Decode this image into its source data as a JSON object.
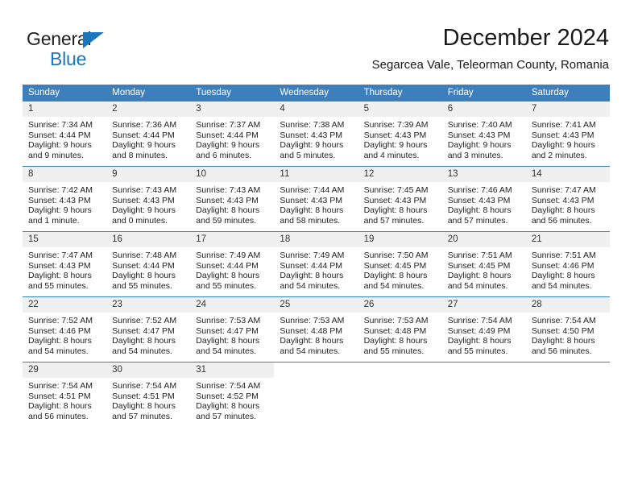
{
  "brand": {
    "name_part1": "General",
    "name_part2": "Blue",
    "logo_icon": "triangle-icon",
    "color_dark": "#231f20",
    "color_blue": "#1b75bb"
  },
  "header": {
    "title": "December 2024",
    "subtitle": "Segarcea Vale, Teleorman County, Romania"
  },
  "calendar": {
    "accent_color": "#3d7ebc",
    "daynum_bg": "#f0f0f0",
    "weekday_headers": [
      "Sunday",
      "Monday",
      "Tuesday",
      "Wednesday",
      "Thursday",
      "Friday",
      "Saturday"
    ],
    "weeks": [
      [
        {
          "day": "1",
          "sunrise": "Sunrise: 7:34 AM",
          "sunset": "Sunset: 4:44 PM",
          "daylight_line1": "Daylight: 9 hours",
          "daylight_line2": "and 9 minutes."
        },
        {
          "day": "2",
          "sunrise": "Sunrise: 7:36 AM",
          "sunset": "Sunset: 4:44 PM",
          "daylight_line1": "Daylight: 9 hours",
          "daylight_line2": "and 8 minutes."
        },
        {
          "day": "3",
          "sunrise": "Sunrise: 7:37 AM",
          "sunset": "Sunset: 4:44 PM",
          "daylight_line1": "Daylight: 9 hours",
          "daylight_line2": "and 6 minutes."
        },
        {
          "day": "4",
          "sunrise": "Sunrise: 7:38 AM",
          "sunset": "Sunset: 4:43 PM",
          "daylight_line1": "Daylight: 9 hours",
          "daylight_line2": "and 5 minutes."
        },
        {
          "day": "5",
          "sunrise": "Sunrise: 7:39 AM",
          "sunset": "Sunset: 4:43 PM",
          "daylight_line1": "Daylight: 9 hours",
          "daylight_line2": "and 4 minutes."
        },
        {
          "day": "6",
          "sunrise": "Sunrise: 7:40 AM",
          "sunset": "Sunset: 4:43 PM",
          "daylight_line1": "Daylight: 9 hours",
          "daylight_line2": "and 3 minutes."
        },
        {
          "day": "7",
          "sunrise": "Sunrise: 7:41 AM",
          "sunset": "Sunset: 4:43 PM",
          "daylight_line1": "Daylight: 9 hours",
          "daylight_line2": "and 2 minutes."
        }
      ],
      [
        {
          "day": "8",
          "sunrise": "Sunrise: 7:42 AM",
          "sunset": "Sunset: 4:43 PM",
          "daylight_line1": "Daylight: 9 hours",
          "daylight_line2": "and 1 minute."
        },
        {
          "day": "9",
          "sunrise": "Sunrise: 7:43 AM",
          "sunset": "Sunset: 4:43 PM",
          "daylight_line1": "Daylight: 9 hours",
          "daylight_line2": "and 0 minutes."
        },
        {
          "day": "10",
          "sunrise": "Sunrise: 7:43 AM",
          "sunset": "Sunset: 4:43 PM",
          "daylight_line1": "Daylight: 8 hours",
          "daylight_line2": "and 59 minutes."
        },
        {
          "day": "11",
          "sunrise": "Sunrise: 7:44 AM",
          "sunset": "Sunset: 4:43 PM",
          "daylight_line1": "Daylight: 8 hours",
          "daylight_line2": "and 58 minutes."
        },
        {
          "day": "12",
          "sunrise": "Sunrise: 7:45 AM",
          "sunset": "Sunset: 4:43 PM",
          "daylight_line1": "Daylight: 8 hours",
          "daylight_line2": "and 57 minutes."
        },
        {
          "day": "13",
          "sunrise": "Sunrise: 7:46 AM",
          "sunset": "Sunset: 4:43 PM",
          "daylight_line1": "Daylight: 8 hours",
          "daylight_line2": "and 57 minutes."
        },
        {
          "day": "14",
          "sunrise": "Sunrise: 7:47 AM",
          "sunset": "Sunset: 4:43 PM",
          "daylight_line1": "Daylight: 8 hours",
          "daylight_line2": "and 56 minutes."
        }
      ],
      [
        {
          "day": "15",
          "sunrise": "Sunrise: 7:47 AM",
          "sunset": "Sunset: 4:43 PM",
          "daylight_line1": "Daylight: 8 hours",
          "daylight_line2": "and 55 minutes."
        },
        {
          "day": "16",
          "sunrise": "Sunrise: 7:48 AM",
          "sunset": "Sunset: 4:44 PM",
          "daylight_line1": "Daylight: 8 hours",
          "daylight_line2": "and 55 minutes."
        },
        {
          "day": "17",
          "sunrise": "Sunrise: 7:49 AM",
          "sunset": "Sunset: 4:44 PM",
          "daylight_line1": "Daylight: 8 hours",
          "daylight_line2": "and 55 minutes."
        },
        {
          "day": "18",
          "sunrise": "Sunrise: 7:49 AM",
          "sunset": "Sunset: 4:44 PM",
          "daylight_line1": "Daylight: 8 hours",
          "daylight_line2": "and 54 minutes."
        },
        {
          "day": "19",
          "sunrise": "Sunrise: 7:50 AM",
          "sunset": "Sunset: 4:45 PM",
          "daylight_line1": "Daylight: 8 hours",
          "daylight_line2": "and 54 minutes."
        },
        {
          "day": "20",
          "sunrise": "Sunrise: 7:51 AM",
          "sunset": "Sunset: 4:45 PM",
          "daylight_line1": "Daylight: 8 hours",
          "daylight_line2": "and 54 minutes."
        },
        {
          "day": "21",
          "sunrise": "Sunrise: 7:51 AM",
          "sunset": "Sunset: 4:46 PM",
          "daylight_line1": "Daylight: 8 hours",
          "daylight_line2": "and 54 minutes."
        }
      ],
      [
        {
          "day": "22",
          "sunrise": "Sunrise: 7:52 AM",
          "sunset": "Sunset: 4:46 PM",
          "daylight_line1": "Daylight: 8 hours",
          "daylight_line2": "and 54 minutes."
        },
        {
          "day": "23",
          "sunrise": "Sunrise: 7:52 AM",
          "sunset": "Sunset: 4:47 PM",
          "daylight_line1": "Daylight: 8 hours",
          "daylight_line2": "and 54 minutes."
        },
        {
          "day": "24",
          "sunrise": "Sunrise: 7:53 AM",
          "sunset": "Sunset: 4:47 PM",
          "daylight_line1": "Daylight: 8 hours",
          "daylight_line2": "and 54 minutes."
        },
        {
          "day": "25",
          "sunrise": "Sunrise: 7:53 AM",
          "sunset": "Sunset: 4:48 PM",
          "daylight_line1": "Daylight: 8 hours",
          "daylight_line2": "and 54 minutes."
        },
        {
          "day": "26",
          "sunrise": "Sunrise: 7:53 AM",
          "sunset": "Sunset: 4:48 PM",
          "daylight_line1": "Daylight: 8 hours",
          "daylight_line2": "and 55 minutes."
        },
        {
          "day": "27",
          "sunrise": "Sunrise: 7:54 AM",
          "sunset": "Sunset: 4:49 PM",
          "daylight_line1": "Daylight: 8 hours",
          "daylight_line2": "and 55 minutes."
        },
        {
          "day": "28",
          "sunrise": "Sunrise: 7:54 AM",
          "sunset": "Sunset: 4:50 PM",
          "daylight_line1": "Daylight: 8 hours",
          "daylight_line2": "and 56 minutes."
        }
      ],
      [
        {
          "day": "29",
          "sunrise": "Sunrise: 7:54 AM",
          "sunset": "Sunset: 4:51 PM",
          "daylight_line1": "Daylight: 8 hours",
          "daylight_line2": "and 56 minutes."
        },
        {
          "day": "30",
          "sunrise": "Sunrise: 7:54 AM",
          "sunset": "Sunset: 4:51 PM",
          "daylight_line1": "Daylight: 8 hours",
          "daylight_line2": "and 57 minutes."
        },
        {
          "day": "31",
          "sunrise": "Sunrise: 7:54 AM",
          "sunset": "Sunset: 4:52 PM",
          "daylight_line1": "Daylight: 8 hours",
          "daylight_line2": "and 57 minutes."
        },
        {
          "day": "",
          "sunrise": "",
          "sunset": "",
          "daylight_line1": "",
          "daylight_line2": ""
        },
        {
          "day": "",
          "sunrise": "",
          "sunset": "",
          "daylight_line1": "",
          "daylight_line2": ""
        },
        {
          "day": "",
          "sunrise": "",
          "sunset": "",
          "daylight_line1": "",
          "daylight_line2": ""
        },
        {
          "day": "",
          "sunrise": "",
          "sunset": "",
          "daylight_line1": "",
          "daylight_line2": ""
        }
      ]
    ]
  }
}
